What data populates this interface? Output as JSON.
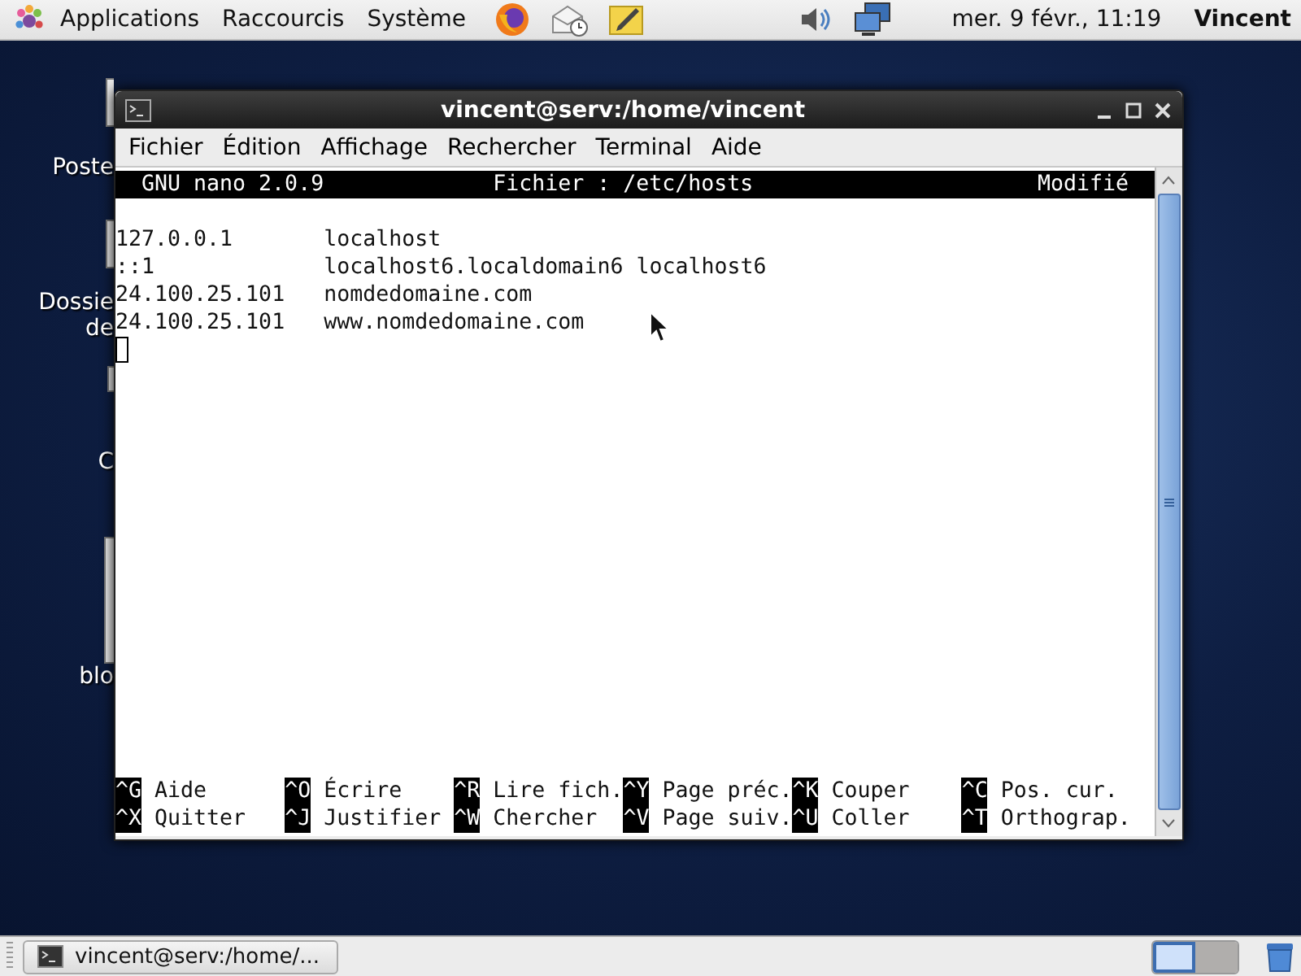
{
  "top_panel": {
    "menus": [
      "Applications",
      "Raccourcis",
      "Système"
    ],
    "clock": "mer.  9 févr., 11:19",
    "user": "Vincent"
  },
  "desktop_icons": [
    {
      "label_lines": [
        "Poste"
      ]
    },
    {
      "label_lines": [
        "Dossie",
        "de"
      ]
    },
    {
      "label_lines": [
        "C"
      ]
    },
    {
      "label_lines": [
        "blo"
      ]
    }
  ],
  "window": {
    "title": "vincent@serv:/home/vincent",
    "menu": [
      "Fichier",
      "Édition",
      "Affichage",
      "Rechercher",
      "Terminal",
      "Aide"
    ],
    "nano": {
      "version": "GNU nano 2.0.9",
      "file": "Fichier : /etc/hosts",
      "status": "Modifié",
      "lines": [
        {
          "address": "127.0.0.1",
          "hosts": "localhost"
        },
        {
          "address": "::1",
          "hosts": "localhost6.localdomain6 localhost6"
        },
        {
          "address": "24.100.25.101",
          "hosts": "nomdedomaine.com"
        },
        {
          "address": "24.100.25.101",
          "hosts": "www.nomdedomaine.com"
        }
      ],
      "shortcuts": [
        {
          "key": "^G",
          "label": "Aide"
        },
        {
          "key": "^O",
          "label": "Écrire"
        },
        {
          "key": "^R",
          "label": "Lire fich."
        },
        {
          "key": "^Y",
          "label": "Page préc."
        },
        {
          "key": "^K",
          "label": "Couper"
        },
        {
          "key": "^C",
          "label": "Pos. cur."
        },
        {
          "key": "^X",
          "label": "Quitter"
        },
        {
          "key": "^J",
          "label": "Justifier"
        },
        {
          "key": "^W",
          "label": "Chercher"
        },
        {
          "key": "^V",
          "label": "Page suiv."
        },
        {
          "key": "^U",
          "label": "Coller"
        },
        {
          "key": "^T",
          "label": "Orthograp."
        }
      ]
    }
  },
  "taskbar": {
    "tasks": [
      {
        "label": "vincent@serv:/home/...",
        "selected": false
      }
    ],
    "workspaces": [
      {
        "selected": true
      },
      {
        "selected": false
      }
    ]
  }
}
